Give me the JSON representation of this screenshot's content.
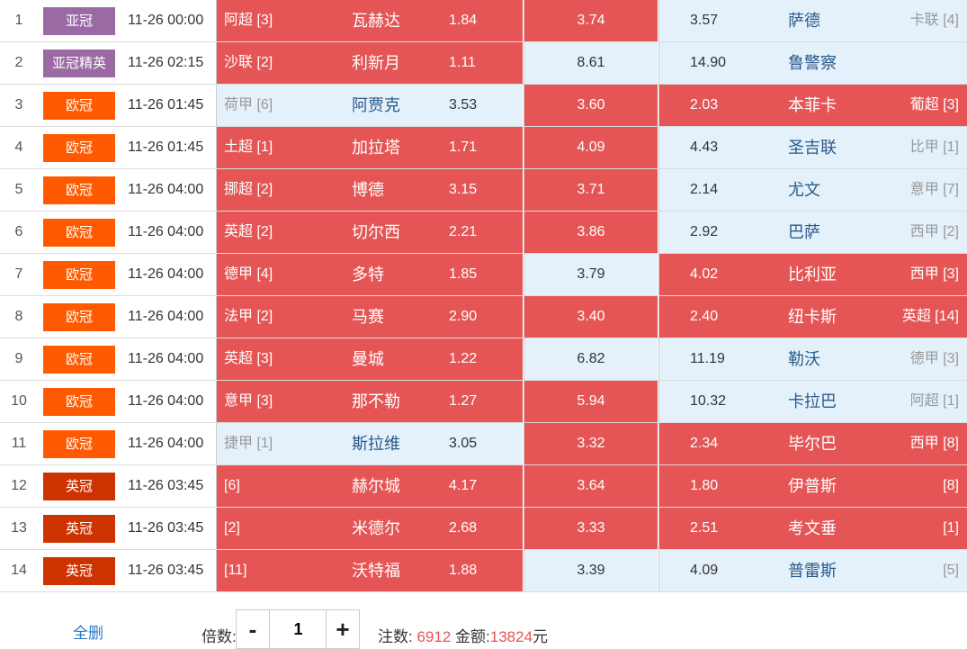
{
  "colors": {
    "selected": "#e55555",
    "unselected": "#e4f1fb"
  },
  "matches": [
    {
      "idx": "1",
      "league": "亚冠",
      "league_color": "#9b6aa5",
      "time": "11-26 00:00",
      "home_rank": "阿超 [3]",
      "home_team": "瓦赫达",
      "home_odds": "1.84",
      "home_sel": true,
      "draw_odds": "3.74",
      "draw_sel": true,
      "away_odds": "3.57",
      "away_team": "萨德",
      "away_rank": "卡联 [4]",
      "away_sel": false
    },
    {
      "idx": "2",
      "league": "亚冠精英",
      "league_color": "#9b6aa5",
      "time": "11-26 02:15",
      "home_rank": "沙联 [2]",
      "home_team": "利新月",
      "home_odds": "1.11",
      "home_sel": true,
      "draw_odds": "8.61",
      "draw_sel": false,
      "away_odds": "14.90",
      "away_team": "鲁警察",
      "away_rank": "",
      "away_sel": false
    },
    {
      "idx": "3",
      "league": "欧冠",
      "league_color": "#ff5a00",
      "time": "11-26 01:45",
      "home_rank": "荷甲 [6]",
      "home_team": "阿贾克",
      "home_odds": "3.53",
      "home_sel": false,
      "draw_odds": "3.60",
      "draw_sel": true,
      "away_odds": "2.03",
      "away_team": "本菲卡",
      "away_rank": "葡超 [3]",
      "away_sel": true
    },
    {
      "idx": "4",
      "league": "欧冠",
      "league_color": "#ff5a00",
      "time": "11-26 01:45",
      "home_rank": "土超 [1]",
      "home_team": "加拉塔",
      "home_odds": "1.71",
      "home_sel": true,
      "draw_odds": "4.09",
      "draw_sel": true,
      "away_odds": "4.43",
      "away_team": "圣吉联",
      "away_rank": "比甲 [1]",
      "away_sel": false
    },
    {
      "idx": "5",
      "league": "欧冠",
      "league_color": "#ff5a00",
      "time": "11-26 04:00",
      "home_rank": "挪超 [2]",
      "home_team": "博德",
      "home_odds": "3.15",
      "home_sel": true,
      "draw_odds": "3.71",
      "draw_sel": true,
      "away_odds": "2.14",
      "away_team": "尤文",
      "away_rank": "意甲 [7]",
      "away_sel": false
    },
    {
      "idx": "6",
      "league": "欧冠",
      "league_color": "#ff5a00",
      "time": "11-26 04:00",
      "home_rank": "英超 [2]",
      "home_team": "切尔西",
      "home_odds": "2.21",
      "home_sel": true,
      "draw_odds": "3.86",
      "draw_sel": true,
      "away_odds": "2.92",
      "away_team": "巴萨",
      "away_rank": "西甲 [2]",
      "away_sel": false
    },
    {
      "idx": "7",
      "league": "欧冠",
      "league_color": "#ff5a00",
      "time": "11-26 04:00",
      "home_rank": "德甲 [4]",
      "home_team": "多特",
      "home_odds": "1.85",
      "home_sel": true,
      "draw_odds": "3.79",
      "draw_sel": false,
      "away_odds": "4.02",
      "away_team": "比利亚",
      "away_rank": "西甲 [3]",
      "away_sel": true
    },
    {
      "idx": "8",
      "league": "欧冠",
      "league_color": "#ff5a00",
      "time": "11-26 04:00",
      "home_rank": "法甲 [2]",
      "home_team": "马赛",
      "home_odds": "2.90",
      "home_sel": true,
      "draw_odds": "3.40",
      "draw_sel": true,
      "away_odds": "2.40",
      "away_team": "纽卡斯",
      "away_rank": "英超 [14]",
      "away_sel": true
    },
    {
      "idx": "9",
      "league": "欧冠",
      "league_color": "#ff5a00",
      "time": "11-26 04:00",
      "home_rank": "英超 [3]",
      "home_team": "曼城",
      "home_odds": "1.22",
      "home_sel": true,
      "draw_odds": "6.82",
      "draw_sel": false,
      "away_odds": "11.19",
      "away_team": "勒沃",
      "away_rank": "德甲 [3]",
      "away_sel": false
    },
    {
      "idx": "10",
      "league": "欧冠",
      "league_color": "#ff5a00",
      "time": "11-26 04:00",
      "home_rank": "意甲 [3]",
      "home_team": "那不勒",
      "home_odds": "1.27",
      "home_sel": true,
      "draw_odds": "5.94",
      "draw_sel": true,
      "away_odds": "10.32",
      "away_team": "卡拉巴",
      "away_rank": "阿超 [1]",
      "away_sel": false
    },
    {
      "idx": "11",
      "league": "欧冠",
      "league_color": "#ff5a00",
      "time": "11-26 04:00",
      "home_rank": "捷甲 [1]",
      "home_team": "斯拉维",
      "home_odds": "3.05",
      "home_sel": false,
      "draw_odds": "3.32",
      "draw_sel": true,
      "away_odds": "2.34",
      "away_team": "毕尔巴",
      "away_rank": "西甲 [8]",
      "away_sel": true
    },
    {
      "idx": "12",
      "league": "英冠",
      "league_color": "#cc3300",
      "time": "11-26 03:45",
      "home_rank": "[6]",
      "home_team": "赫尔城",
      "home_odds": "4.17",
      "home_sel": true,
      "draw_odds": "3.64",
      "draw_sel": true,
      "away_odds": "1.80",
      "away_team": "伊普斯",
      "away_rank": "[8]",
      "away_sel": true
    },
    {
      "idx": "13",
      "league": "英冠",
      "league_color": "#cc3300",
      "time": "11-26 03:45",
      "home_rank": "[2]",
      "home_team": "米德尔",
      "home_odds": "2.68",
      "home_sel": true,
      "draw_odds": "3.33",
      "draw_sel": true,
      "away_odds": "2.51",
      "away_team": "考文垂",
      "away_rank": "[1]",
      "away_sel": true
    },
    {
      "idx": "14",
      "league": "英冠",
      "league_color": "#cc3300",
      "time": "11-26 03:45",
      "home_rank": "[11]",
      "home_team": "沃特福",
      "home_odds": "1.88",
      "home_sel": true,
      "draw_odds": "3.39",
      "draw_sel": false,
      "away_odds": "4.09",
      "away_team": "普雷斯",
      "away_rank": "[5]",
      "away_sel": false
    }
  ],
  "footer": {
    "clear_label": "全删",
    "multiplier_label": "倍数:",
    "minus_label": "-",
    "plus_label": "+",
    "multiplier_value": "1",
    "bets_label": "注数:",
    "bets_value": "6912",
    "amount_label": "金额:",
    "amount_value": "13824",
    "amount_unit": "元"
  }
}
